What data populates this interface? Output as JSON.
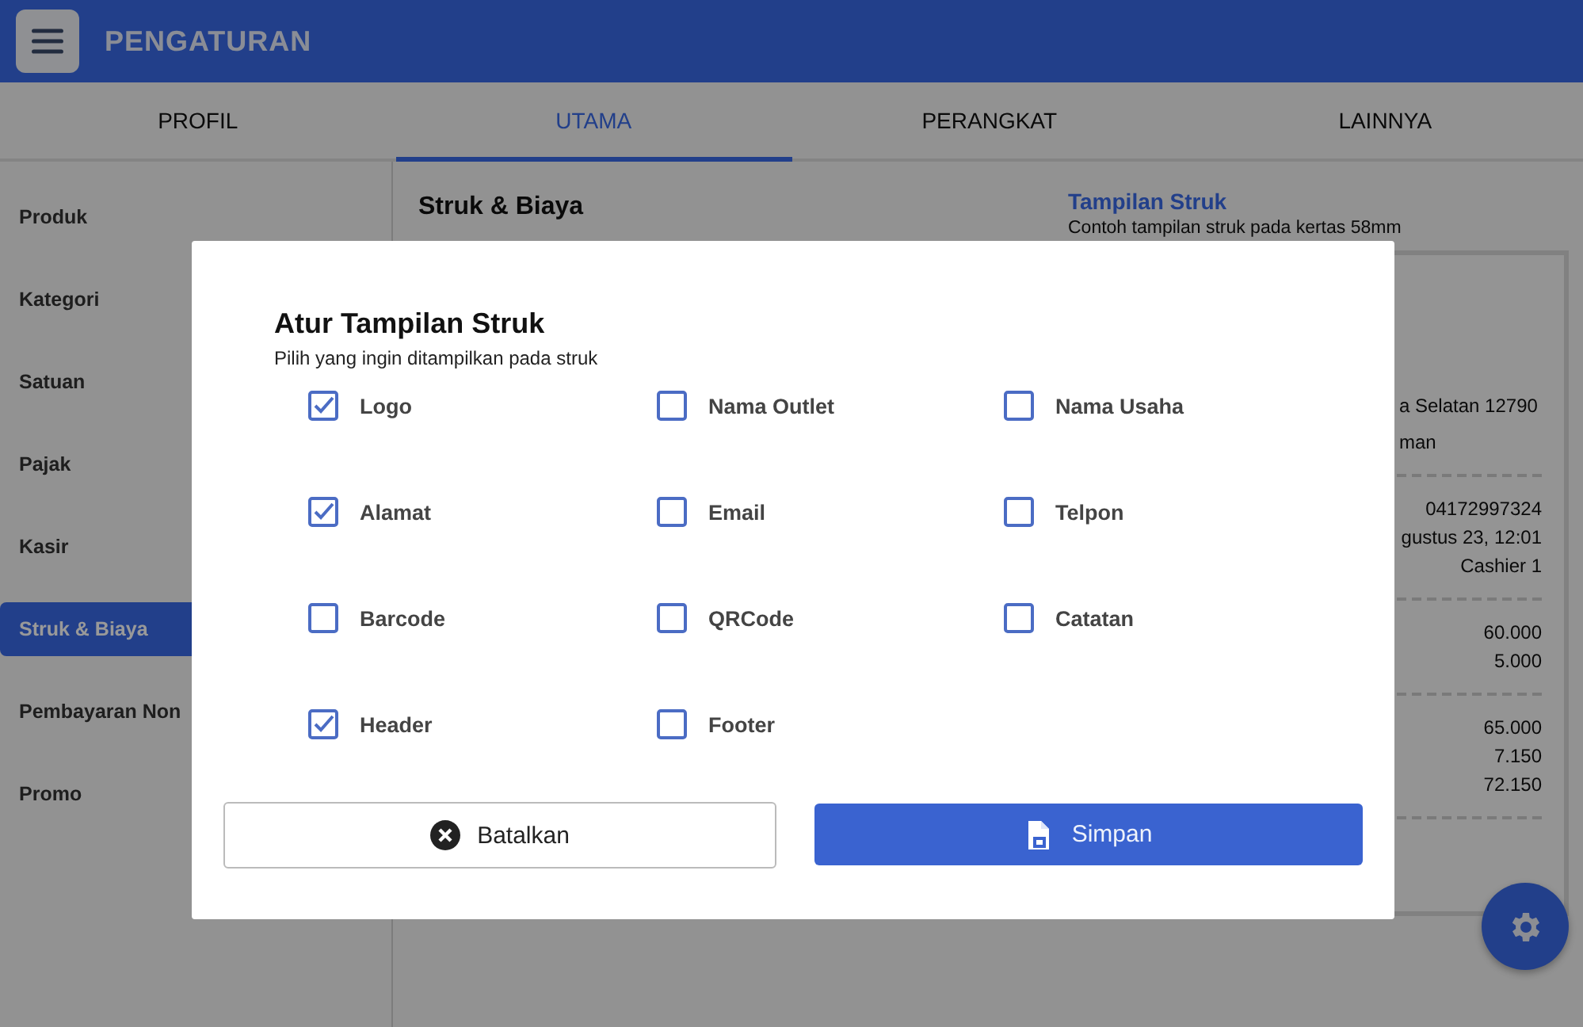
{
  "header": {
    "title": "PENGATURAN"
  },
  "tabs": [
    {
      "label": "PROFIL",
      "selected": false
    },
    {
      "label": "UTAMA",
      "selected": true
    },
    {
      "label": "PERANGKAT",
      "selected": false
    },
    {
      "label": "LAINNYA",
      "selected": false
    }
  ],
  "sidebar": {
    "items": [
      {
        "label": "Produk",
        "selected": false
      },
      {
        "label": "Kategori",
        "selected": false
      },
      {
        "label": "Satuan",
        "selected": false
      },
      {
        "label": "Pajak",
        "selected": false
      },
      {
        "label": "Kasir",
        "selected": false
      },
      {
        "label": "Struk & Biaya",
        "selected": true
      },
      {
        "label": "Pembayaran Non",
        "selected": false
      },
      {
        "label": "Promo",
        "selected": false
      }
    ]
  },
  "section": {
    "title": "Struk & Biaya"
  },
  "preview": {
    "title": "Tampilan Struk",
    "subtitle": "Contoh tampilan struk pada kertas 58mm",
    "lines": [
      {
        "kind": "gap"
      },
      {
        "kind": "left",
        "text": "a Selatan 12790"
      },
      {
        "kind": "left",
        "text": "man"
      },
      {
        "kind": "rule"
      },
      {
        "kind": "right",
        "text": "04172997324"
      },
      {
        "kind": "right",
        "text": "gustus 23, 12:01"
      },
      {
        "kind": "right",
        "text": "Cashier 1"
      },
      {
        "kind": "rule"
      },
      {
        "kind": "right",
        "text": "60.000"
      },
      {
        "kind": "right",
        "text": "5.000"
      },
      {
        "kind": "rule"
      },
      {
        "kind": "right",
        "text": "65.000"
      },
      {
        "kind": "right",
        "text": "7.150"
      },
      {
        "kind": "right",
        "text": "72.150"
      },
      {
        "kind": "rule"
      }
    ]
  },
  "dialog": {
    "title": "Atur Tampilan Struk",
    "subtitle": "Pilih yang ingin ditampilkan pada struk",
    "options": [
      {
        "label": "Logo",
        "checked": true
      },
      {
        "label": "Nama Outlet",
        "checked": false
      },
      {
        "label": "Nama Usaha",
        "checked": false
      },
      {
        "label": "Alamat",
        "checked": true
      },
      {
        "label": "Email",
        "checked": false
      },
      {
        "label": "Telpon",
        "checked": false
      },
      {
        "label": "Barcode",
        "checked": false
      },
      {
        "label": "QRCode",
        "checked": false
      },
      {
        "label": "Catatan",
        "checked": false
      },
      {
        "label": "Header",
        "checked": true
      },
      {
        "label": "Footer",
        "checked": false
      }
    ],
    "buttons": [
      {
        "kind": "cancel",
        "label": "Batalkan"
      },
      {
        "kind": "save",
        "label": "Simpan"
      }
    ]
  }
}
